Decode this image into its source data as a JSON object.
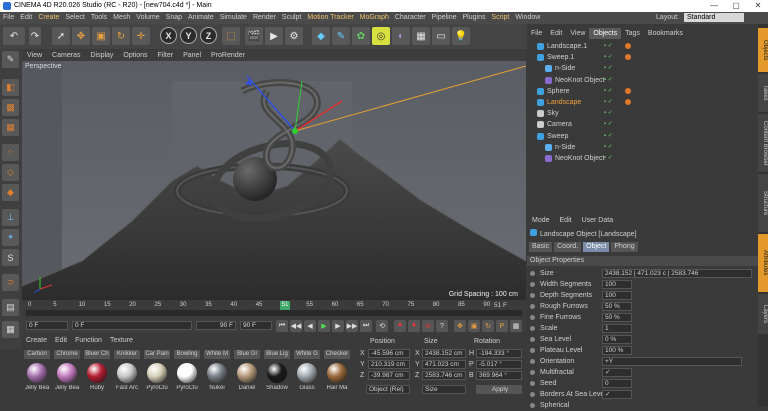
{
  "window": {
    "title": "CINEMA 4D R20.026 Studio (RC - R20) - [new704.c4d *] - Main",
    "controls": [
      "—",
      "▢",
      "✕"
    ]
  },
  "menubar": {
    "items": [
      "File",
      "Edit",
      "Create",
      "Select",
      "Tools",
      "Mesh",
      "Volume",
      "Snap",
      "Animate",
      "Simulate",
      "Render",
      "Sculpt",
      "Motion Tracker",
      "MoGraph",
      "Character",
      "Pipeline",
      "Plugins",
      "Script",
      "Window"
    ],
    "layout_label": "Layout:",
    "layout_value": "Standard"
  },
  "toolbar": {
    "axis_labels": [
      "X",
      "Y",
      "Z"
    ]
  },
  "viewport": {
    "menu": [
      "View",
      "Cameras",
      "Display",
      "Options",
      "Filter",
      "Panel",
      "ProRender"
    ],
    "label": "Perspective",
    "grid_spacing": "Grid Spacing : 100 cm"
  },
  "timeline": {
    "ticks": [
      "0",
      "5",
      "10",
      "15",
      "20",
      "25",
      "30",
      "35",
      "40",
      "45",
      "50",
      "55",
      "60",
      "65",
      "70",
      "75",
      "80",
      "85",
      "90"
    ],
    "current_marker": "51",
    "end_label": "51 F"
  },
  "playback": {
    "start_field": "0 F",
    "current_field": "0 F",
    "end_field": "90 F",
    "max_field": "90 F"
  },
  "materials": {
    "menu": [
      "Create",
      "Edit",
      "Function",
      "Texture"
    ],
    "row1": [
      {
        "label": "Carbon",
        "name": "Jelly Bea",
        "color": "#a86fb0"
      },
      {
        "label": "Chrome",
        "name": "Jelly Bea",
        "color": "#c47cc0"
      },
      {
        "label": "Bluer Ch",
        "name": "Ruby",
        "color": "#b51e32"
      },
      {
        "label": "Knikker",
        "name": "Fast Arc",
        "color": "#c8c8c8"
      },
      {
        "label": "Car Pain",
        "name": "PyroClu",
        "color": "#d6d0b8"
      },
      {
        "label": "Bowling",
        "name": "PyroClu",
        "color": "#ffffff"
      },
      {
        "label": "White M",
        "name": "Nukei",
        "color": "#7a8088"
      },
      {
        "label": "Blue Gl",
        "name": "Daniel",
        "color": "#b59a7a"
      },
      {
        "label": "Blue Lig",
        "name": "Shadow",
        "color": "#1a1a1a"
      },
      {
        "label": "White G",
        "name": "Glass",
        "color": "#a2aab0"
      },
      {
        "label": "Checker",
        "name": "Hair Ma",
        "color": "#9a6a3a"
      }
    ]
  },
  "coords": {
    "headers": [
      "Position",
      "Size",
      "Rotation"
    ],
    "rows": [
      {
        "axis": "X",
        "pos": "-45.596 cm",
        "size": "2438.152 cm",
        "rot_label": "H",
        "rot": "-194.333 °"
      },
      {
        "axis": "Y",
        "pos": "210.319 cm",
        "size": "471.023 cm",
        "rot_label": "P",
        "rot": "-5.017 °"
      },
      {
        "axis": "Z",
        "pos": "-39.987 cm",
        "size": "2583.746 cm",
        "rot_label": "B",
        "rot": "369.964 °"
      }
    ],
    "mode": "Object (Rel)",
    "size_mode": "Size",
    "apply": "Apply"
  },
  "objects": {
    "menu": [
      "File",
      "Edit",
      "View",
      "Objects",
      "Tags",
      "Bookmarks"
    ],
    "rows": [
      {
        "name": "Landscape.1",
        "indent": 1,
        "icon": "#3fa0e0",
        "tag": true,
        "hl": false
      },
      {
        "name": "Sweep.1",
        "indent": 1,
        "icon": "#3fa0e0",
        "tag": true,
        "hl": false
      },
      {
        "name": "n-Side",
        "indent": 2,
        "icon": "#5ab0f0",
        "tag": false,
        "hl": false
      },
      {
        "name": "NeoKnot Object",
        "indent": 2,
        "icon": "#8a6ad0",
        "tag": false,
        "hl": false
      },
      {
        "name": "Sphere",
        "indent": 1,
        "icon": "#3fa0e0",
        "tag": true,
        "hl": false
      },
      {
        "name": "Landscape",
        "indent": 1,
        "icon": "#3fa0e0",
        "tag": true,
        "hl": true
      },
      {
        "name": "Sky",
        "indent": 1,
        "icon": "#cccccc",
        "tag": false,
        "hl": false
      },
      {
        "name": "Camera",
        "indent": 1,
        "icon": "#cccccc",
        "tag": false,
        "hl": false
      },
      {
        "name": "Sweep",
        "indent": 1,
        "icon": "#3fa0e0",
        "tag": false,
        "hl": false
      },
      {
        "name": "n-Side",
        "indent": 2,
        "icon": "#5ab0f0",
        "tag": false,
        "hl": false
      },
      {
        "name": "NeoKnot Object",
        "indent": 2,
        "icon": "#8a6ad0",
        "tag": false,
        "hl": false
      }
    ]
  },
  "attributes": {
    "menu": [
      "Mode",
      "Edit",
      "User Data"
    ],
    "title": "Landscape Object [Landscape]",
    "tabs": [
      "Basic",
      "Coord.",
      "Object",
      "Phong"
    ],
    "section": "Object Properties",
    "props": [
      {
        "label": "Size",
        "value": "2438.152 | 471.023 c | 2583.746"
      },
      {
        "label": "Width Segments",
        "value": "100"
      },
      {
        "label": "Depth Segments",
        "value": "100"
      },
      {
        "label": "Rough Furrows",
        "value": "50 %"
      },
      {
        "label": "Fine Furrows",
        "value": "50 %"
      },
      {
        "label": "Scale",
        "value": "1"
      },
      {
        "label": "Sea Level",
        "value": "0 %"
      },
      {
        "label": "Plateau Level",
        "value": "100 %"
      },
      {
        "label": "Orientation",
        "value": "+Y"
      },
      {
        "label": "Multifractal",
        "value": "✓"
      },
      {
        "label": "Seed",
        "value": "0"
      },
      {
        "label": "Borders At Sea Level",
        "value": "✓"
      },
      {
        "label": "Spherical",
        "value": ""
      }
    ]
  },
  "sidetabs": [
    "Objects",
    "Takes",
    "Content Browser",
    "Structure",
    "Attributes",
    "Layers"
  ]
}
